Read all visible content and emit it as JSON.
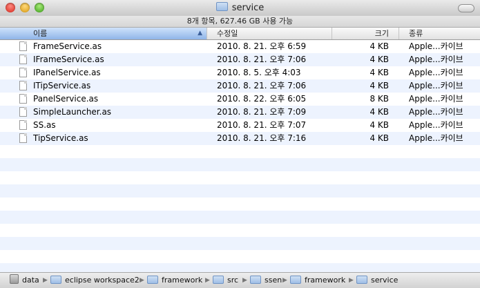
{
  "window": {
    "title": "service"
  },
  "status": "8개 항목, 627.46 GB 사용 가능",
  "columns": {
    "name": "이름",
    "date": "수정일",
    "size": "크기",
    "kind": "종류",
    "sort_indicator": "▲"
  },
  "files": [
    {
      "name": "FrameService.as",
      "date": "2010. 8. 21. 오후 6:59",
      "size": "4 KB",
      "kind": "Apple...카이브"
    },
    {
      "name": "IFrameService.as",
      "date": "2010. 8. 21. 오후 7:06",
      "size": "4 KB",
      "kind": "Apple...카이브"
    },
    {
      "name": "IPanelService.as",
      "date": "2010. 8. 5. 오후 4:03",
      "size": "4 KB",
      "kind": "Apple...카이브"
    },
    {
      "name": "ITipService.as",
      "date": "2010. 8. 21. 오후 7:06",
      "size": "4 KB",
      "kind": "Apple...카이브"
    },
    {
      "name": "PanelService.as",
      "date": "2010. 8. 22. 오후 6:05",
      "size": "8 KB",
      "kind": "Apple...카이브"
    },
    {
      "name": "SimpleLauncher.as",
      "date": "2010. 8. 21. 오후 7:09",
      "size": "4 KB",
      "kind": "Apple...카이브"
    },
    {
      "name": "SS.as",
      "date": "2010. 8. 21. 오후 7:07",
      "size": "4 KB",
      "kind": "Apple...카이브"
    },
    {
      "name": "TipService.as",
      "date": "2010. 8. 21. 오후 7:16",
      "size": "4 KB",
      "kind": "Apple...카이브"
    }
  ],
  "path": [
    {
      "label": "data",
      "icon": "disk-icon"
    },
    {
      "label": "eclipse workspace2",
      "icon": "folder-icon"
    },
    {
      "label": "framework",
      "icon": "folder-icon"
    },
    {
      "label": "src",
      "icon": "folder-icon"
    },
    {
      "label": "ssen",
      "icon": "folder-icon"
    },
    {
      "label": "framework",
      "icon": "folder-icon"
    },
    {
      "label": "service",
      "icon": "folder-icon"
    }
  ],
  "path_separator": "▶",
  "colors": {
    "stripe": "#edf3fe",
    "sorted_header": "#8fb5e8"
  }
}
